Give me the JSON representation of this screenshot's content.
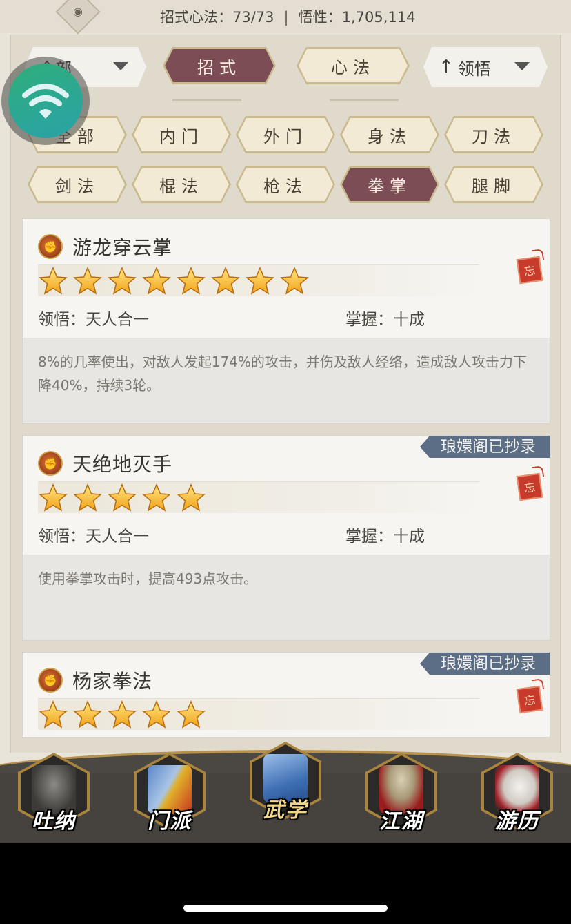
{
  "stats": {
    "moves_label": "招式心法：73/73",
    "separator": "|",
    "insight_label": "悟性：1,705,114"
  },
  "filters": {
    "category_dropdown": "全部",
    "tab_moves": "招式",
    "tab_heart": "心法",
    "sort_dropdown": "领悟",
    "sort_arrow": "↑"
  },
  "types": {
    "row1": [
      "全部",
      "内门",
      "外门",
      "身法",
      "刀法"
    ],
    "row2": [
      "剑法",
      "棍法",
      "枪法",
      "拳掌",
      "腿脚"
    ],
    "active": "拳掌"
  },
  "cards": [
    {
      "name": "游龙穿云掌",
      "stars": 8,
      "comprehension": "领悟：天人合一",
      "mastery": "掌握：十成",
      "desc": "8%的几率使出，对敌人发起174%的攻击，并伤及敌人经络，造成敌人攻击力下降40%，持续3轮。",
      "tag": "",
      "seal": "忘"
    },
    {
      "name": "天绝地灭手",
      "stars": 5,
      "comprehension": "领悟：天人合一",
      "mastery": "掌握：十成",
      "desc": "使用拳掌攻击时，提高493点攻击。",
      "tag": "琅嬛阁已抄录",
      "seal": "忘"
    },
    {
      "name": "杨家拳法",
      "stars": 5,
      "comprehension": "",
      "mastery": "",
      "desc": "",
      "tag": "琅嬛阁已抄录",
      "seal": "忘"
    }
  ],
  "nav": [
    {
      "label": "吐纳",
      "icon": "meditating-figure-icon"
    },
    {
      "label": "门派",
      "icon": "sect-banners-icon"
    },
    {
      "label": "武学",
      "icon": "martial-manual-icon"
    },
    {
      "label": "江湖",
      "icon": "straw-hat-icon"
    },
    {
      "label": "游历",
      "icon": "white-horse-icon"
    }
  ],
  "colors": {
    "active_tab": "#7d4d55",
    "tag_bg": "#5b6e86",
    "nav_bg": "#46433f",
    "gold": "#b7924f"
  }
}
